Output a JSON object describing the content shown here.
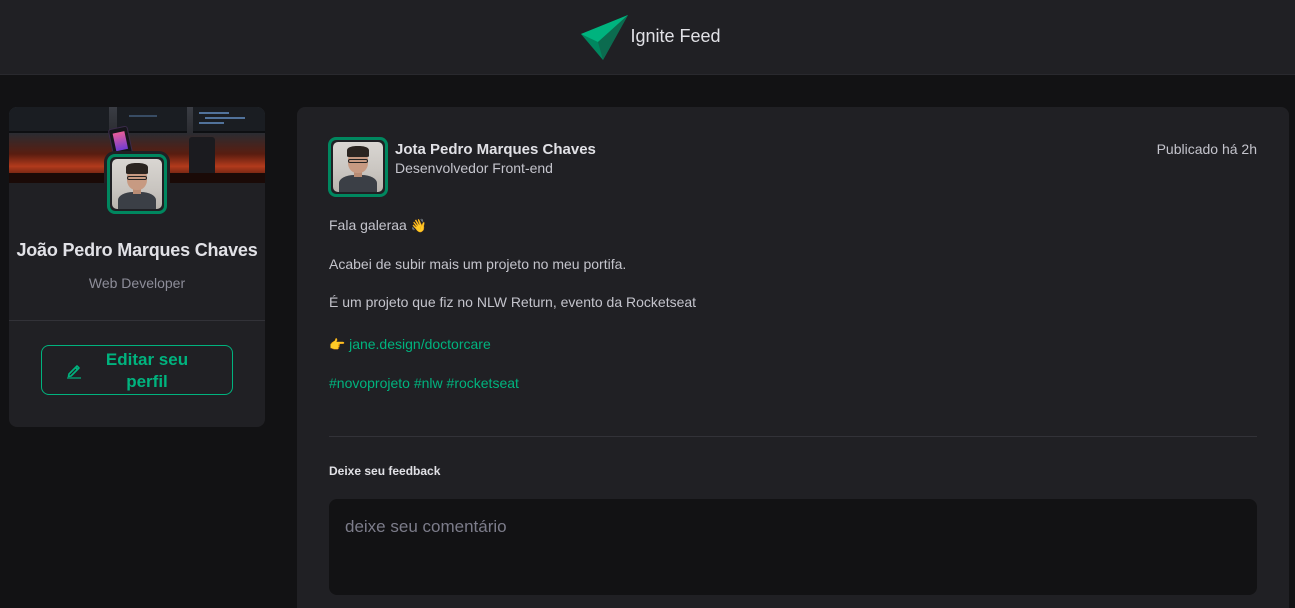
{
  "header": {
    "title": "Ignite Feed",
    "logo_icon": "paper-plane-logo-icon",
    "accent": "#00875f"
  },
  "sidebar": {
    "name": "João Pedro Marques Chaves",
    "role": "Web Developer",
    "edit_label": "Editar seu perfil",
    "edit_icon": "pencil-icon",
    "cover_icon": "desk-setup-cover-image"
  },
  "post": {
    "author_name": "Jota Pedro Marques Chaves",
    "author_role": "Desenvolvedor Front-end",
    "published": "Publicado há 2h",
    "greeting": "Fala galeraa",
    "greeting_emoji": "👋",
    "line1": "Acabei de subir mais um projeto no meu portifa.",
    "line2": "É um projeto que fiz no NLW Return, evento da Rocketseat",
    "link_emoji": "👉",
    "link": "jane.design/doctorcare",
    "hashtags": [
      "#novoprojeto",
      "#nlw",
      "#rocketseat"
    ]
  },
  "feedback": {
    "title": "Deixe seu feedback",
    "placeholder": "deixe seu comentário"
  },
  "colors": {
    "brand": "#00b37e",
    "brand_dark": "#00875f",
    "background": "#121214",
    "card": "#202024"
  }
}
